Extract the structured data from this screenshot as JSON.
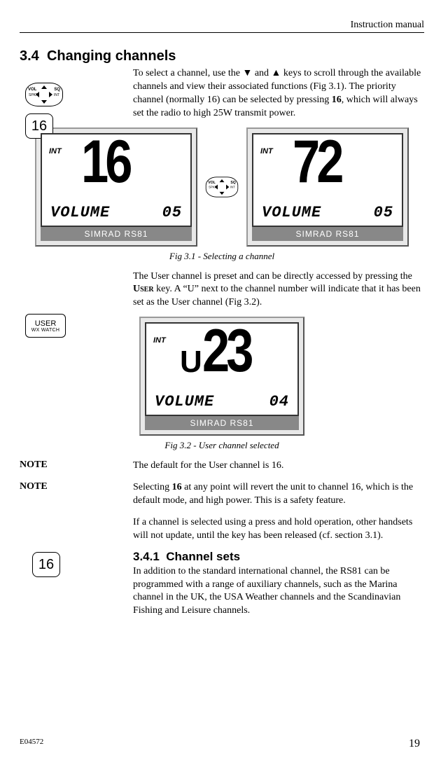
{
  "header_title": "Instruction manual",
  "section": {
    "number": "3.4",
    "title": "Changing channels"
  },
  "margin_keys": {
    "dpad_vol": "VOL",
    "dpad_sq": "SQ",
    "dpad_spkr": "SPKR",
    "dpad_int": "INT",
    "key16_label": "16",
    "user_label": "USER",
    "user_sub": "WX WATCH"
  },
  "para1_a": "To select a channel, use the ",
  "para1_b": " and ",
  "para1_c": " keys to scroll through the available channels and view their associated functions (Fig 3.1). The priority channel (normally 16) can be selected by pressing ",
  "para1_bold": "16",
  "para1_d": ", which will always set the radio to high 25W transmit power.",
  "fig31": {
    "left": {
      "int": "INT",
      "channel": "16",
      "volume_label": "VOLUME",
      "volume_value": "05",
      "device": "SIMRAD RS81"
    },
    "right": {
      "int": "INT",
      "channel": "72",
      "volume_label": "VOLUME",
      "volume_value": "05",
      "device": "SIMRAD RS81"
    },
    "caption": "Fig 3.1 - Selecting a channel"
  },
  "para2_a": "The User channel is preset and can be directly accessed by pressing the ",
  "para2_key": "User",
  "para2_b": " key. A “U” next to the channel number will indicate that it has been set as the User channel (Fig 3.2).",
  "fig32": {
    "int": "INT",
    "u": "U",
    "channel": "23",
    "volume_label": "VOLUME",
    "volume_value": "04",
    "device": "SIMRAD RS81",
    "caption": "Fig 3.2 - User channel selected"
  },
  "notes": {
    "label": "NOTE",
    "n1": "The default for the User channel is 16.",
    "n2_a": "Selecting ",
    "n2_bold": "16",
    "n2_b": " at any point will revert the unit to channel 16, which is the default mode, and high power. This is a safety feature."
  },
  "para3": "If a channel is selected using a press and hold operation, other handsets will not update, until the key has been released (cf. section 3.1).",
  "subsection": {
    "number": "3.4.1",
    "title": "Channel sets"
  },
  "para4": "In addition to the standard international channel, the RS81 can be programmed with a range of auxiliary channels, such as the Marina channel in the UK, the USA Weather channels and the Scandinavian Fishing and Leisure channels.",
  "footer": {
    "code": "E04572",
    "page": "19"
  }
}
